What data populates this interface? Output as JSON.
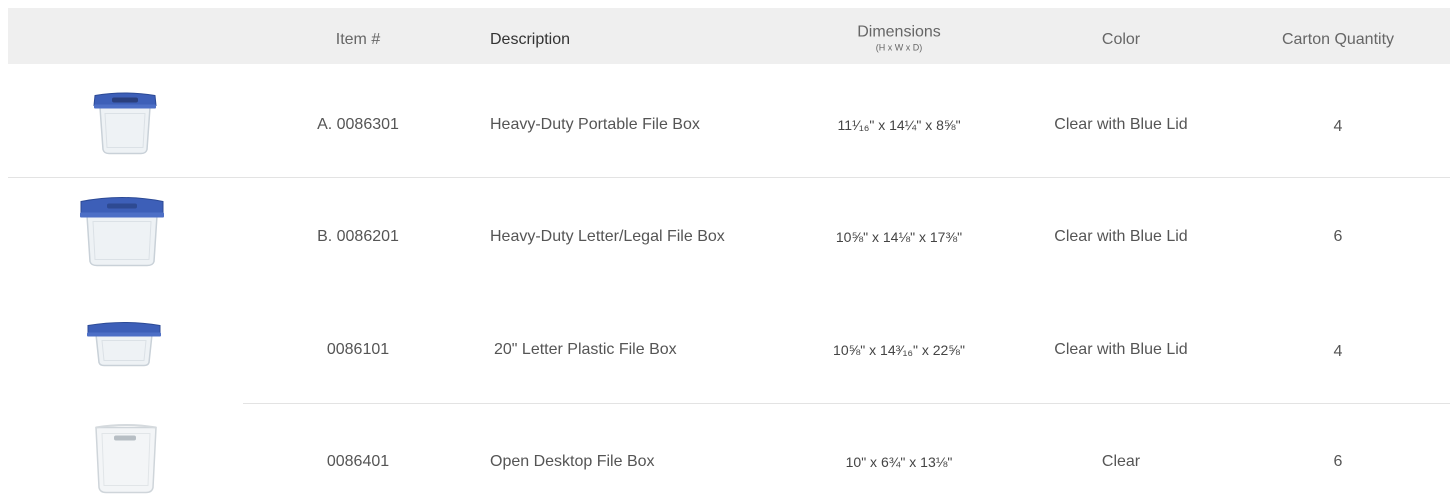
{
  "header": {
    "item": "Item #",
    "description": "Description",
    "dimensions": "Dimensions",
    "dimensions_sub": "(H x W x D)",
    "color": "Color",
    "carton": "Carton Quantity"
  },
  "rows": [
    {
      "image": "portable-file-box-icon",
      "item": "A. 0086301",
      "description": "Heavy-Duty Portable File Box",
      "dimensions": "11¹⁄₁₆\" x 14¼\" x 8⅝\"",
      "color": "Clear with Blue Lid",
      "carton": "4"
    },
    {
      "image": "letter-legal-file-box-icon",
      "item": "B. 0086201",
      "description": "Heavy-Duty Letter/Legal File Box",
      "dimensions": "10⅝\" x 14⅛\" x 17⅜\"",
      "color": "Clear with Blue Lid",
      "carton": "6"
    },
    {
      "image": "letter-plastic-file-box-icon",
      "item": "0086101",
      "description": "20\" Letter Plastic File Box",
      "dimensions": "10⅝\" x 14³⁄₁₆\" x 22⅝\"",
      "color": "Clear with Blue Lid",
      "carton": "4"
    },
    {
      "image": "open-desktop-file-box-icon",
      "item": "0086401",
      "description": "Open Desktop File Box",
      "dimensions": "10\" x 6¾\" x 13⅛\"",
      "color": "Clear",
      "carton": "6"
    }
  ],
  "colors": {
    "header_bg": "#efefef",
    "lid_blue": "#3d5fb8",
    "clear_box": "#e9eef2"
  }
}
